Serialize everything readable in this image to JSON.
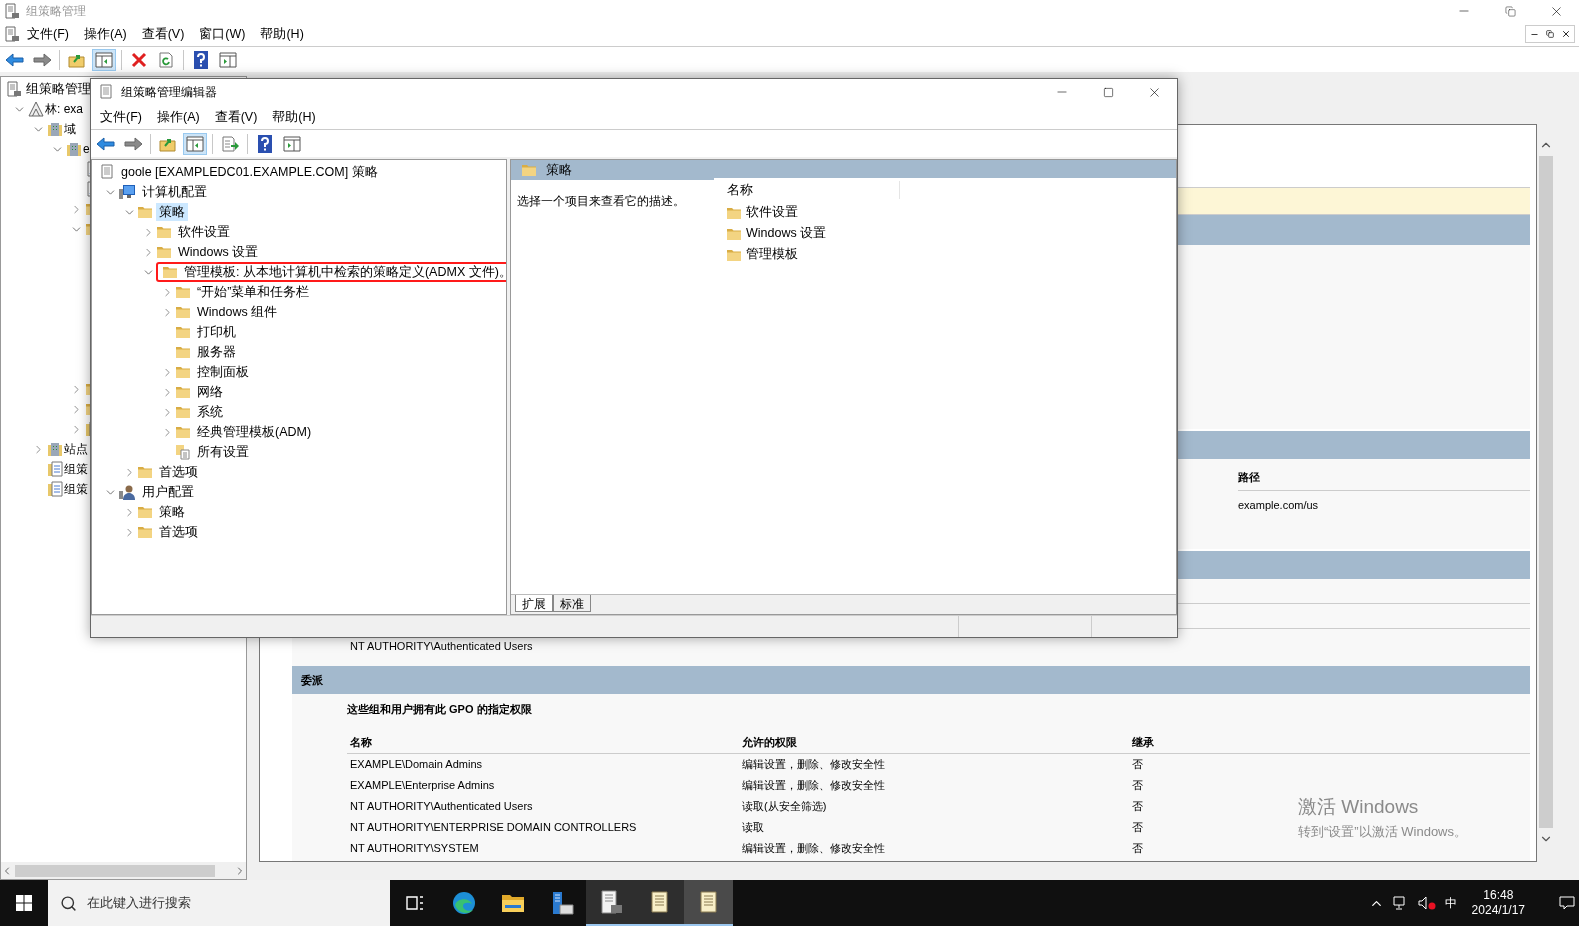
{
  "main_window": {
    "title": "组策略管理",
    "menu": [
      "文件(F)",
      "操作(A)",
      "查看(V)",
      "窗口(W)",
      "帮助(H)"
    ],
    "toolbar": [
      {
        "kind": "back",
        "pressed": false
      },
      {
        "kind": "forward",
        "pressed": false
      },
      {
        "kind": "sep"
      },
      {
        "kind": "up",
        "pressed": false
      },
      {
        "kind": "tree",
        "pressed": true
      },
      {
        "kind": "sep"
      },
      {
        "kind": "delete",
        "pressed": false
      },
      {
        "kind": "refresh",
        "pressed": false
      },
      {
        "kind": "sep"
      },
      {
        "kind": "help",
        "pressed": false
      },
      {
        "kind": "action",
        "pressed": false
      }
    ]
  },
  "console_tree": {
    "root": {
      "label": "组策略管理",
      "kind": "console"
    },
    "items": [
      {
        "label": "林: exa",
        "kind": "forest",
        "expanded": true,
        "children": [
          {
            "label": "域",
            "kind": "domains",
            "expanded": true,
            "children": [
              {
                "label": "e",
                "kind": "domain",
                "expanded": true,
                "children": [
                  {
                    "kind": "link"
                  },
                  {
                    "kind": "link"
                  },
                  {
                    "kind": "ou",
                    "expanded": false
                  },
                  {
                    "kind": "ou",
                    "expanded": true
                  },
                  {
                    "kind": "ou",
                    "expanded": false
                  },
                  {
                    "kind": "ou",
                    "expanded": false
                  },
                  {
                    "kind": "modeling",
                    "expanded": false
                  }
                ]
              }
            ]
          },
          {
            "label": "站点",
            "kind": "sites",
            "expanded": false
          },
          {
            "label": "组策",
            "kind": "modeling"
          },
          {
            "label": "组策",
            "kind": "results"
          }
        ]
      }
    ]
  },
  "report": {
    "links": {
      "columns": [
        "路径"
      ],
      "rows": [
        [
          "example.com/us"
        ]
      ]
    },
    "security_filtering": {
      "rows": [
        "NT AUTHORITY\\Authenticated Users"
      ]
    },
    "delegation": {
      "title": "委派",
      "subtitle": "这些组和用户拥有此 GPO 的指定权限",
      "columns": [
        "名称",
        "允许的权限",
        "继承"
      ],
      "rows": [
        [
          "EXAMPLE\\Domain Admins",
          "编辑设置，删除、修改安全性",
          "否"
        ],
        [
          "EXAMPLE\\Enterprise Admins",
          "编辑设置，删除、修改安全性",
          "否"
        ],
        [
          "NT AUTHORITY\\Authenticated Users",
          "读取(从安全筛选)",
          "否"
        ],
        [
          "NT AUTHORITY\\ENTERPRISE DOMAIN CONTROLLERS",
          "读取",
          "否"
        ],
        [
          "NT AUTHORITY\\SYSTEM",
          "编辑设置，删除、修改安全性",
          "否"
        ]
      ]
    }
  },
  "editor": {
    "title": "组策略管理编辑器",
    "menu": [
      "文件(F)",
      "操作(A)",
      "查看(V)",
      "帮助(H)"
    ],
    "toolbar": [
      {
        "kind": "back",
        "pressed": false
      },
      {
        "kind": "forward",
        "pressed": false
      },
      {
        "kind": "sep"
      },
      {
        "kind": "up",
        "pressed": false
      },
      {
        "kind": "tree",
        "pressed": true
      },
      {
        "kind": "sep"
      },
      {
        "kind": "export",
        "pressed": false
      },
      {
        "kind": "sep"
      },
      {
        "kind": "help",
        "pressed": false
      },
      {
        "kind": "action",
        "pressed": false
      }
    ],
    "tree": [
      {
        "label": "goole [EXAMPLEDC01.EXAMPLE.COM] 策略",
        "kind": "policy",
        "children": [
          {
            "label": "计算机配置",
            "kind": "computer",
            "expanded": true,
            "selected": false,
            "children": [
              {
                "label": "策略",
                "kind": "folder",
                "expanded": true,
                "selected": true,
                "children": [
                  {
                    "label": "软件设置",
                    "kind": "folder",
                    "expanded": false,
                    "selected": false
                  },
                  {
                    "label": "Windows 设置",
                    "kind": "folder",
                    "expanded": false,
                    "selected": false
                  },
                  {
                    "label": "管理模板: 从本地计算机中检索的策略定义(ADMX 文件)。",
                    "kind": "folder",
                    "expanded": true,
                    "selected": false,
                    "annotated": true,
                    "children": [
                      {
                        "label": "“开始”菜单和任务栏",
                        "kind": "folder",
                        "expanded": false,
                        "selected": false
                      },
                      {
                        "label": "Windows 组件",
                        "kind": "folder",
                        "expanded": false,
                        "selected": false
                      },
                      {
                        "label": "打印机",
                        "kind": "folder",
                        "selected": false
                      },
                      {
                        "label": "服务器",
                        "kind": "folder",
                        "selected": false
                      },
                      {
                        "label": "控制面板",
                        "kind": "folder",
                        "expanded": false,
                        "selected": false
                      },
                      {
                        "label": "网络",
                        "kind": "folder",
                        "expanded": false,
                        "selected": false
                      },
                      {
                        "label": "系统",
                        "kind": "folder",
                        "expanded": false,
                        "selected": false
                      },
                      {
                        "label": "经典管理模板(ADM)",
                        "kind": "folder",
                        "expanded": false,
                        "selected": false
                      },
                      {
                        "label": "所有设置",
                        "kind": "all-settings",
                        "selected": false
                      }
                    ]
                  }
                ]
              },
              {
                "label": "首选项",
                "kind": "folder",
                "expanded": false,
                "selected": false
              }
            ]
          },
          {
            "label": "用户配置",
            "kind": "user",
            "expanded": true,
            "selected": false,
            "children": [
              {
                "label": "策略",
                "kind": "folder",
                "expanded": false,
                "selected": false
              },
              {
                "label": "首选项",
                "kind": "folder",
                "expanded": false,
                "selected": false
              }
            ]
          }
        ]
      }
    ],
    "detail": {
      "heading": "策略",
      "description": "选择一个项目来查看它的描述。",
      "column": "名称",
      "items": [
        "软件设置",
        "Windows 设置",
        "管理模板"
      ]
    },
    "tabs": [
      {
        "label": "扩展",
        "selected": true
      },
      {
        "label": "标准",
        "selected": false
      }
    ]
  },
  "taskbar": {
    "search_placeholder": "在此键入进行搜索",
    "apps": [
      {
        "kind": "task-view",
        "running": false,
        "focused": false
      },
      {
        "kind": "edge",
        "running": false,
        "focused": false
      },
      {
        "kind": "explorer",
        "running": false,
        "focused": false
      },
      {
        "kind": "server-manager",
        "running": false,
        "focused": false
      },
      {
        "kind": "console",
        "running": true,
        "focused": false
      },
      {
        "kind": "policy",
        "running": true,
        "focused": false
      },
      {
        "kind": "policy",
        "running": true,
        "focused": true
      }
    ],
    "ime": "中",
    "time": "16:48",
    "date": "2024/1/17"
  },
  "activation_notice": {
    "title": "激活 Windows",
    "hint": "转到“设置”以激活 Windows。"
  }
}
